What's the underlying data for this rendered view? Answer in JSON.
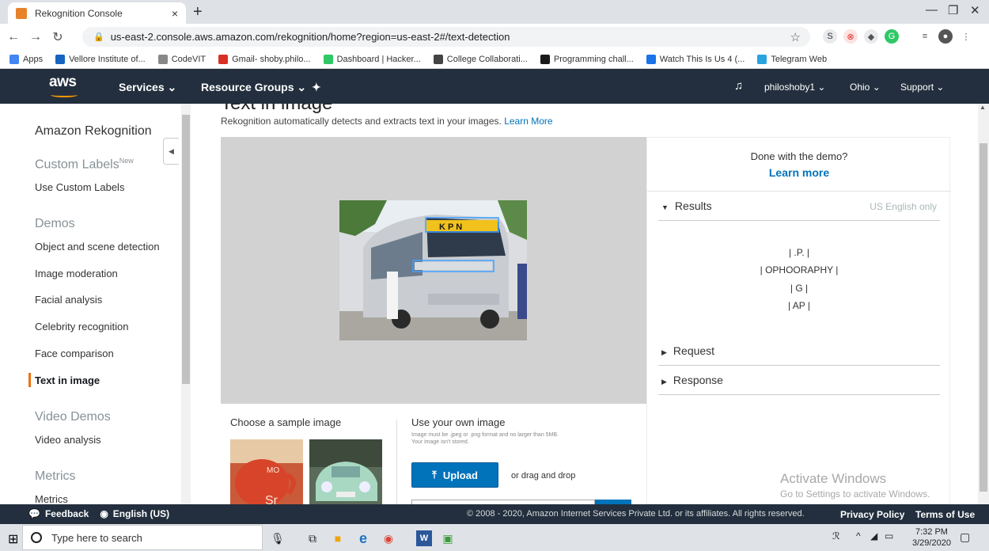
{
  "browser": {
    "tab_title": "Rekognition Console",
    "tab_close": "×",
    "new_tab": "+",
    "url": "us-east-2.console.aws.amazon.com/rekognition/home?region=us-east-2#/text-detection",
    "bookmarks": [
      {
        "label": "Apps",
        "color": "#4285f4"
      },
      {
        "label": "Vellore Institute of...",
        "color": "#1565c0"
      },
      {
        "label": "CodeVIT",
        "color": "#888888"
      },
      {
        "label": "Gmail- shoby.philo...",
        "color": "#d93025"
      },
      {
        "label": "Dashboard | Hacker...",
        "color": "#2ec866"
      },
      {
        "label": "College Collaborati...",
        "color": "#444444"
      },
      {
        "label": "Programming chall...",
        "color": "#1a1a1a"
      },
      {
        "label": "Watch This Is Us 4 (...",
        "color": "#1a73e8"
      },
      {
        "label": "Telegram Web",
        "color": "#2aa3df"
      }
    ]
  },
  "aws": {
    "logo": "aws",
    "services": "Services",
    "resource_groups": "Resource Groups",
    "user": "philoshoby1",
    "region": "Ohio",
    "support": "Support"
  },
  "sidebar": {
    "title": "Amazon Rekognition",
    "custom_labels_heading": "Custom Labels",
    "custom_labels_badge": "New",
    "use_custom_labels": "Use Custom Labels",
    "demos_heading": "Demos",
    "demos": [
      "Object and scene detection",
      "Image moderation",
      "Facial analysis",
      "Celebrity recognition",
      "Face comparison",
      "Text in image"
    ],
    "video_heading": "Video Demos",
    "video_analysis": "Video analysis",
    "metrics_heading": "Metrics",
    "metrics_item": "Metrics"
  },
  "main": {
    "page_title": "Text in image",
    "intro": "Rekognition automatically detects and extracts text in your images.",
    "intro_link": "Learn More",
    "sample_title": "Choose a sample image",
    "own_title": "Use your own image",
    "own_note": "Image must be .jpeg or .png format and no larger than 5MB. Your image isn't stored.",
    "upload_label": "Upload",
    "drag_drop": "or drag and drop",
    "bus_sign": "K P N"
  },
  "results_panel": {
    "done_text": "Done with the demo?",
    "learn_more": "Learn more",
    "results_label": "Results",
    "us_only": "US English only",
    "results": [
      "| .P. |",
      "| OPHOORAPHY |",
      "| G |",
      "| AP |"
    ],
    "request_label": "Request",
    "response_label": "Response"
  },
  "watermark": {
    "line1": "Activate Windows",
    "line2": "Go to Settings to activate Windows."
  },
  "footer": {
    "feedback": "Feedback",
    "language": "English (US)",
    "copyright": "© 2008 - 2020, Amazon Internet Services Private Ltd. or its affiliates. All rights reserved.",
    "privacy": "Privacy Policy",
    "terms": "Terms of Use"
  },
  "taskbar": {
    "search_placeholder": "Type here to search",
    "time": "7:32 PM",
    "date": "3/29/2020"
  }
}
